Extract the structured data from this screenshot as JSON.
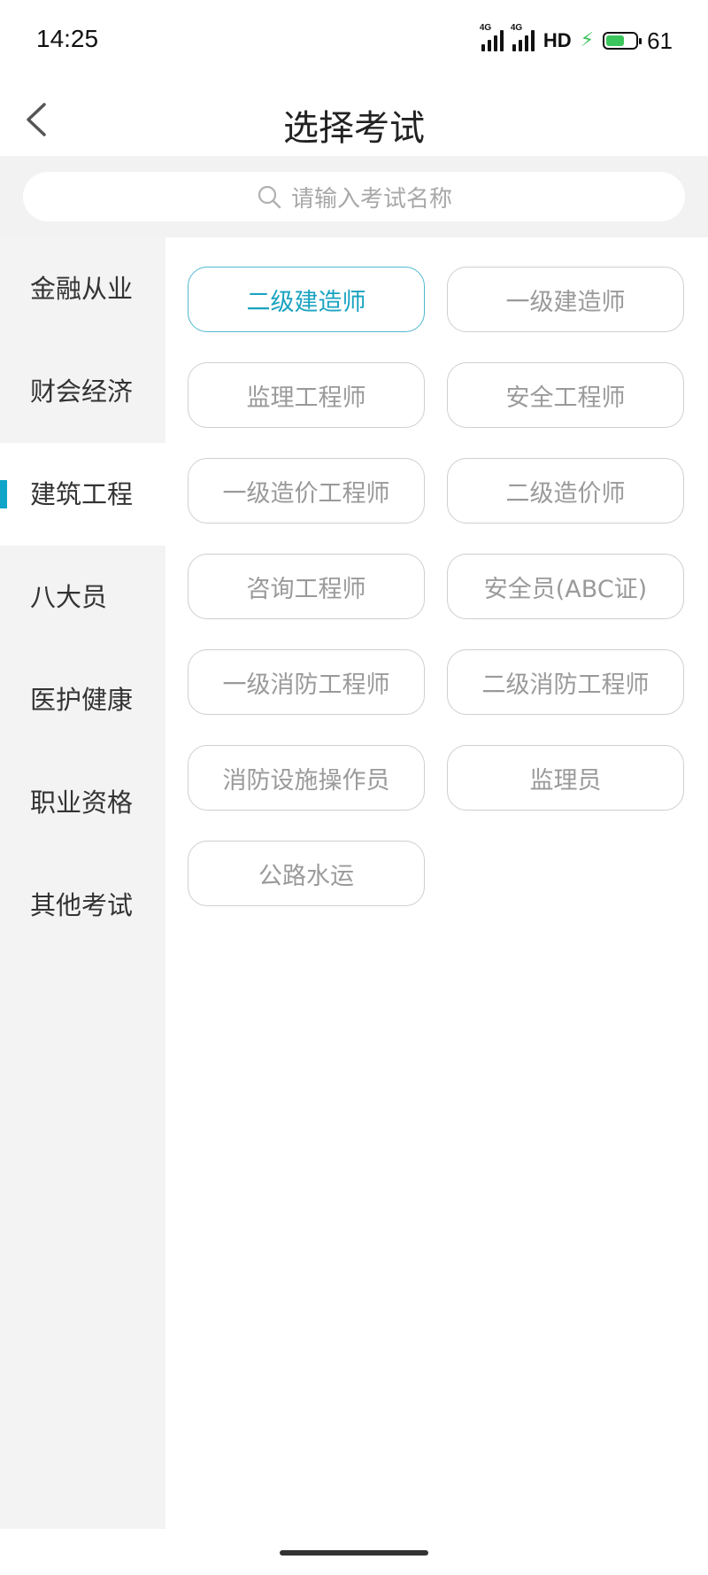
{
  "status_bar": {
    "time": "14:25",
    "network_1": "4G",
    "network_2": "4G",
    "hd": "HD",
    "battery": "61",
    "battery_level": 0.61,
    "charging_color": "#3cc55c"
  },
  "header": {
    "title": "选择考试",
    "back_icon": "chevron-left-icon"
  },
  "search": {
    "placeholder": "请输入考试名称",
    "icon": "search-icon"
  },
  "sidebar": {
    "active_color": "#0ea5c8",
    "items": [
      {
        "label": "金融从业"
      },
      {
        "label": "财会经济"
      },
      {
        "label": "建筑工程",
        "active": true
      },
      {
        "label": "八大员"
      },
      {
        "label": "医护健康"
      },
      {
        "label": "职业资格"
      },
      {
        "label": "其他考试"
      }
    ]
  },
  "exams": {
    "selected_color": "#1aa3c0",
    "items": [
      {
        "label": "二级建造师",
        "selected": true
      },
      {
        "label": "一级建造师"
      },
      {
        "label": "监理工程师"
      },
      {
        "label": "安全工程师"
      },
      {
        "label": "一级造价工程师"
      },
      {
        "label": "二级造价师"
      },
      {
        "label": "咨询工程师"
      },
      {
        "label": "安全员(ABC证)"
      },
      {
        "label": "一级消防工程师"
      },
      {
        "label": "二级消防工程师"
      },
      {
        "label": "消防设施操作员"
      },
      {
        "label": "监理员"
      },
      {
        "label": "公路水运"
      }
    ]
  }
}
